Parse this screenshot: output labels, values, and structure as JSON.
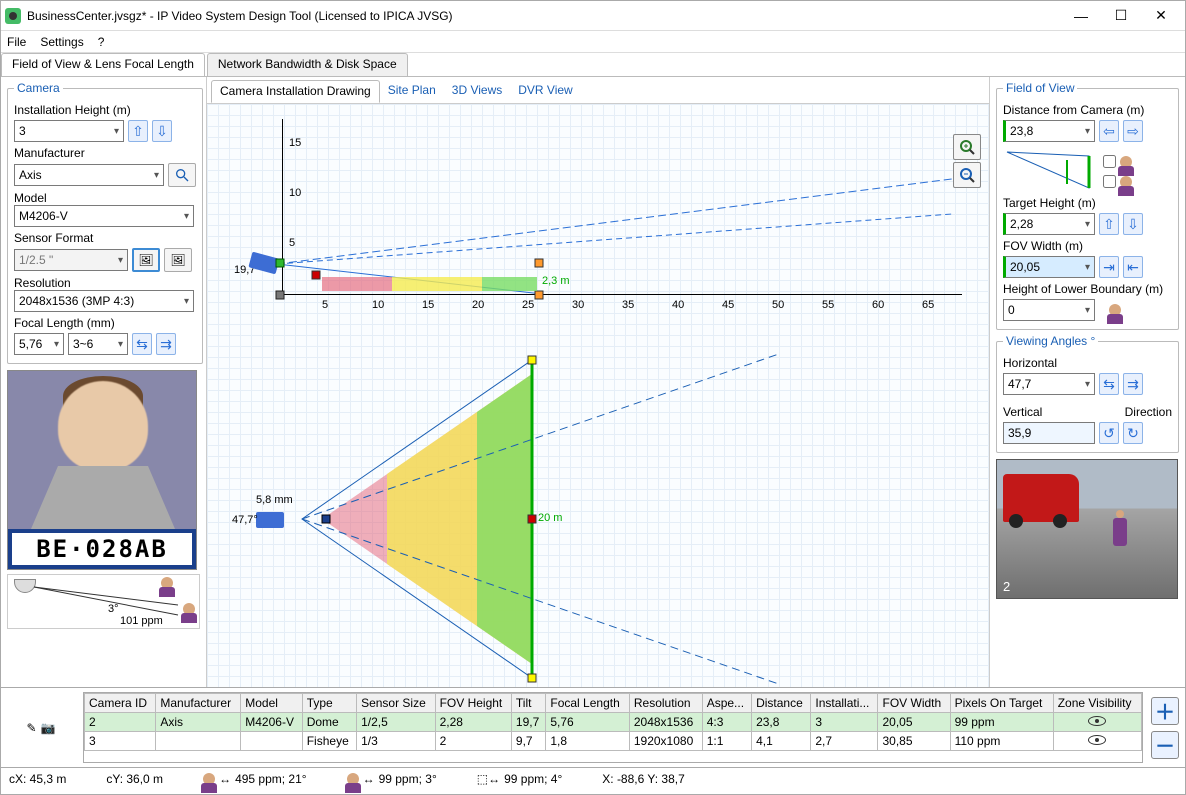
{
  "window": {
    "title": "BusinessCenter.jvsgz* - IP Video System Design Tool (Licensed to IPICA JVSG)"
  },
  "menu": {
    "file": "File",
    "settings": "Settings",
    "help": "?"
  },
  "main_tabs": {
    "fov": "Field of View & Lens Focal Length",
    "network": "Network Bandwidth & Disk Space"
  },
  "camera_panel": {
    "legend": "Camera",
    "install_height_label": "Installation Height (m)",
    "install_height": "3",
    "manufacturer_label": "Manufacturer",
    "manufacturer": "Axis",
    "model_label": "Model",
    "model": "M4206-V",
    "sensor_label": "Sensor Format",
    "sensor": "1/2.5 \"",
    "resolution_label": "Resolution",
    "resolution": "2048x1536 (3MP 4:3)",
    "focal_label": "Focal Length (mm)",
    "focal": "5,76",
    "focal_range": "3~6",
    "plate": "BE·028AB",
    "angle_text": "3°",
    "ppm_text": "101 ppm"
  },
  "center_tabs": {
    "drawing": "Camera Installation Drawing",
    "siteplan": "Site Plan",
    "views3d": "3D Views",
    "dvr": "DVR View"
  },
  "drawing": {
    "side_tilt_label": "19,7°",
    "side_target_label": "2,3 m",
    "top_focal_label": "5,8 mm",
    "top_hfov_label": "47,7°",
    "top_width_label": "20 m",
    "x_ticks": [
      "5",
      "10",
      "15",
      "20",
      "25",
      "30",
      "35",
      "40",
      "45",
      "50",
      "55",
      "60",
      "65"
    ],
    "y_ticks": [
      "5",
      "10",
      "15"
    ]
  },
  "fov_panel": {
    "legend": "Field of View",
    "distance_label": "Distance from Camera  (m)",
    "distance": "23,8",
    "target_height_label": "Target Height (m)",
    "target_height": "2,28",
    "fov_width_label": "FOV Width (m)",
    "fov_width": "20,05",
    "lower_boundary_label": "Height of Lower Boundary (m)",
    "lower_boundary": "0"
  },
  "angles_panel": {
    "legend": "Viewing Angles °",
    "horizontal_label": "Horizontal",
    "horizontal": "47,7",
    "vertical_label": "Vertical",
    "vertical": "35,9",
    "direction_label": "Direction"
  },
  "scene_label": "2",
  "table": {
    "headers": [
      "Camera ID",
      "Manufacturer",
      "Model",
      "Type",
      "Sensor Size",
      "FOV Height",
      "Tilt",
      "Focal Length",
      "Resolution",
      "Aspe...",
      "Distance",
      "Installati...",
      "FOV Width",
      "Pixels On Target",
      "Zone Visibility"
    ],
    "rows": [
      {
        "id": "2",
        "mfr": "Axis",
        "model": "M4206-V",
        "type": "Dome",
        "sensor": "1/2,5",
        "fovh": "2,28",
        "tilt": "19,7",
        "fl": "5,76",
        "res": "2048x1536",
        "aspect": "4:3",
        "dist": "23,8",
        "inst": "3",
        "fovw": "20,05",
        "ppm": "99 ppm"
      },
      {
        "id": "3",
        "mfr": "",
        "model": "",
        "type": "Fisheye",
        "sensor": "1/3",
        "fovh": "2",
        "tilt": "9,7",
        "fl": "1,8",
        "res": "1920x1080",
        "aspect": "1:1",
        "dist": "4,1",
        "inst": "2,7",
        "fovw": "30,85",
        "ppm": "110 ppm"
      }
    ]
  },
  "status": {
    "cx": "cX: 45,3 m",
    "cy": "cY: 36,0 m",
    "s1": "495 ppm; 21°",
    "s2": "99 ppm; 3°",
    "s3": "99 ppm; 4°",
    "coords": "X: -88,6 Y: 38,7"
  }
}
